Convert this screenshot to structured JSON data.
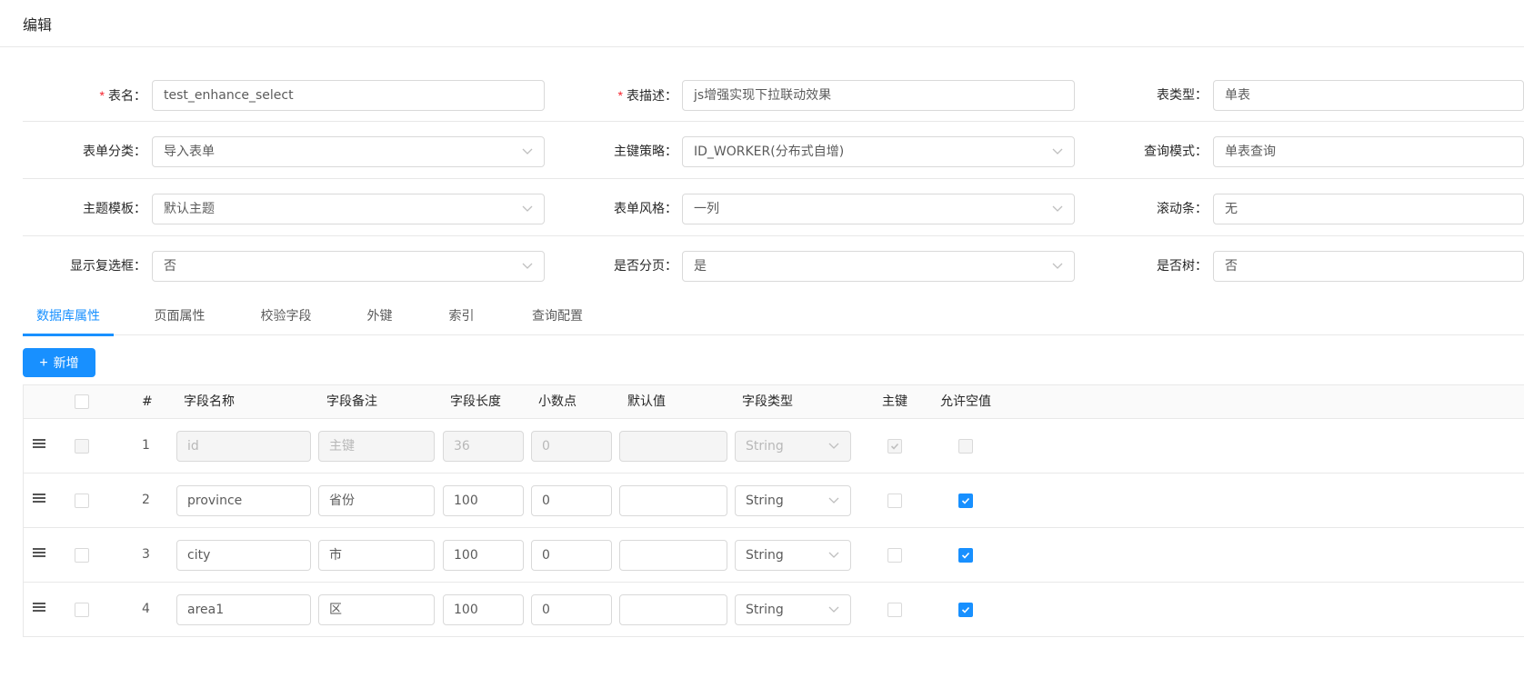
{
  "header": {
    "title": "编辑"
  },
  "form": {
    "table_name": {
      "label": "表名",
      "value": "test_enhance_select"
    },
    "table_desc": {
      "label": "表描述",
      "value": "js增强实现下拉联动效果"
    },
    "table_type": {
      "label": "表类型",
      "value": "单表"
    },
    "form_category": {
      "label": "表单分类",
      "value": "导入表单"
    },
    "pk_strategy": {
      "label": "主键策略",
      "value": "ID_WORKER(分布式自增)"
    },
    "query_mode": {
      "label": "查询模式",
      "value": "单表查询"
    },
    "theme_template": {
      "label": "主题模板",
      "value": "默认主题"
    },
    "form_style": {
      "label": "表单风格",
      "value": "一列"
    },
    "scrollbar": {
      "label": "滚动条",
      "value": "无"
    },
    "show_checkbox": {
      "label": "显示复选框",
      "value": "否"
    },
    "paginate": {
      "label": "是否分页",
      "value": "是"
    },
    "is_tree": {
      "label": "是否树",
      "value": "否"
    },
    "colon": "："
  },
  "tabs": [
    {
      "label": "数据库属性",
      "active": true
    },
    {
      "label": "页面属性",
      "active": false
    },
    {
      "label": "校验字段",
      "active": false
    },
    {
      "label": "外键",
      "active": false
    },
    {
      "label": "索引",
      "active": false
    },
    {
      "label": "查询配置",
      "active": false
    }
  ],
  "add_button": {
    "label": "新增",
    "icon": "plus-icon"
  },
  "table": {
    "columns": [
      "#",
      "字段名称",
      "字段备注",
      "字段长度",
      "小数点",
      "默认值",
      "字段类型",
      "主键",
      "允许空值"
    ],
    "rows": [
      {
        "index": "1",
        "name": "id",
        "comment": "主键",
        "length": "36",
        "decimal": "0",
        "default": "",
        "type": "String",
        "pk": true,
        "nullable": false,
        "disabled": true
      },
      {
        "index": "2",
        "name": "province",
        "comment": "省份",
        "length": "100",
        "decimal": "0",
        "default": "",
        "type": "String",
        "pk": false,
        "nullable": true,
        "disabled": false
      },
      {
        "index": "3",
        "name": "city",
        "comment": "市",
        "length": "100",
        "decimal": "0",
        "default": "",
        "type": "String",
        "pk": false,
        "nullable": true,
        "disabled": false
      },
      {
        "index": "4",
        "name": "area1",
        "comment": "区",
        "length": "100",
        "decimal": "0",
        "default": "",
        "type": "String",
        "pk": false,
        "nullable": true,
        "disabled": false
      }
    ]
  },
  "colors": {
    "primary": "#1890ff",
    "required": "#f5222d",
    "border": "#d9d9d9"
  }
}
